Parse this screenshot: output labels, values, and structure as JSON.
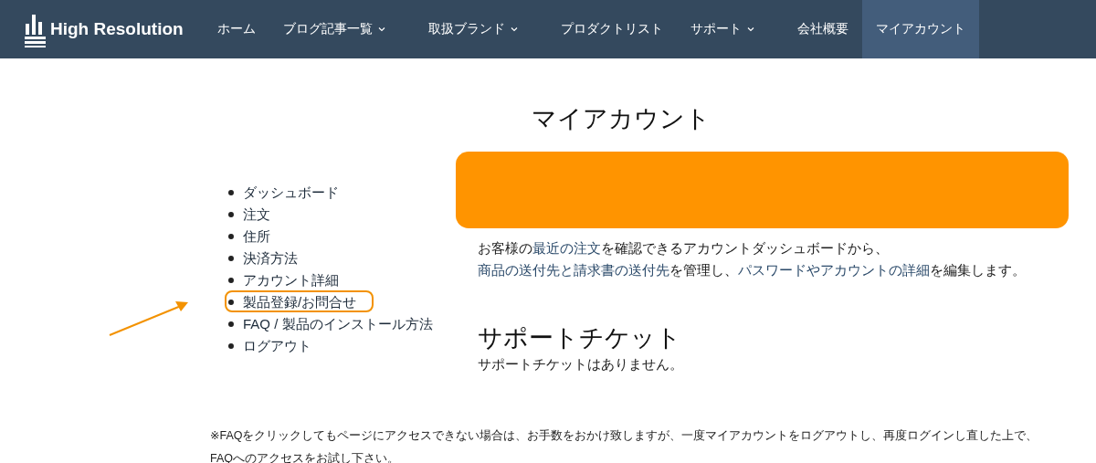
{
  "logo": {
    "text": "High Resolution"
  },
  "nav": [
    {
      "label": "ホーム",
      "dropdown": false,
      "selected": false
    },
    {
      "label": "ブログ記事一覧",
      "dropdown": true,
      "selected": false
    },
    {
      "label": "取扱ブランド",
      "dropdown": true,
      "selected": false
    },
    {
      "label": "プロダクトリスト",
      "dropdown": false,
      "selected": false
    },
    {
      "label": "サポート",
      "dropdown": true,
      "selected": false
    },
    {
      "label": "会社概要",
      "dropdown": false,
      "selected": false
    },
    {
      "label": "マイアカウント",
      "dropdown": false,
      "selected": true
    }
  ],
  "page_title": "マイアカウント",
  "account_menu": [
    {
      "label": "ダッシュボード",
      "highlighted": false
    },
    {
      "label": "注文",
      "highlighted": false
    },
    {
      "label": "住所",
      "highlighted": false
    },
    {
      "label": "決済方法",
      "highlighted": false
    },
    {
      "label": "アカウント詳細",
      "highlighted": false
    },
    {
      "label": "製品登録/お問合せ",
      "highlighted": true
    },
    {
      "label": "FAQ / 製品のインストール方法",
      "highlighted": false
    },
    {
      "label": "ログアウト",
      "highlighted": false
    }
  ],
  "intro": [
    {
      "kind": "text",
      "text": "お客様の"
    },
    {
      "kind": "link",
      "text": "最近の注文"
    },
    {
      "kind": "text",
      "text": "を確認できるアカウントダッシュボードから、"
    },
    {
      "kind": "link",
      "text": "商品の送付先と請求書の送付先"
    },
    {
      "kind": "text",
      "text": "を管理し、"
    },
    {
      "kind": "link",
      "text": "パスワードやアカウントの詳細"
    },
    {
      "kind": "text",
      "text": "を編集します。"
    }
  ],
  "support": {
    "title": "サポートチケット",
    "message": "サポートチケットはありません。"
  },
  "footnote": "※FAQをクリックしてもページにアクセスできない場合は、お手数をおかけ致しますが、一度マイアカウントをログアウトし、再度ログインし直した上で、FAQへのアクセスをお試し下さい。"
}
